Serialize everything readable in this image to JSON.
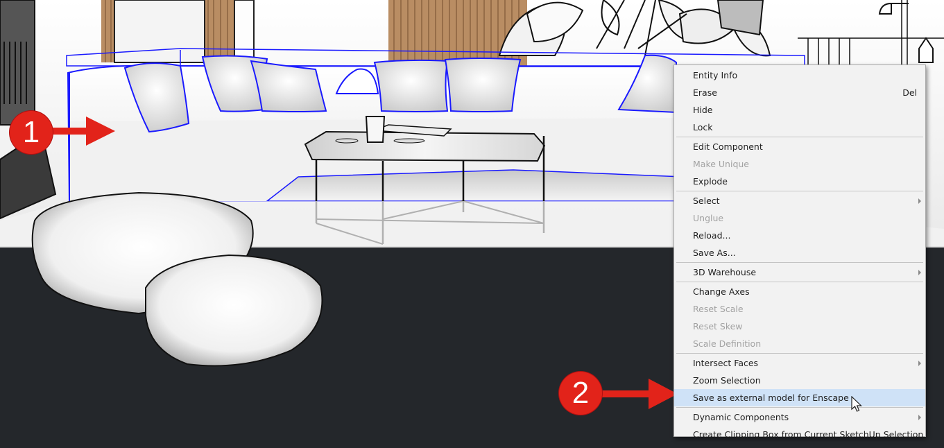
{
  "context_menu": {
    "items": [
      {
        "label": "Entity Info",
        "enabled": true
      },
      {
        "label": "Erase",
        "shortcut": "Del",
        "enabled": true
      },
      {
        "label": "Hide",
        "enabled": true
      },
      {
        "label": "Lock",
        "enabled": true
      },
      {
        "label": "Edit Component",
        "enabled": true
      },
      {
        "label": "Make Unique",
        "enabled": false
      },
      {
        "label": "Explode",
        "enabled": true
      },
      {
        "label": "Select",
        "submenu": true,
        "enabled": true
      },
      {
        "label": "Unglue",
        "enabled": false
      },
      {
        "label": "Reload...",
        "enabled": true
      },
      {
        "label": "Save As...",
        "enabled": true
      },
      {
        "label": "3D Warehouse",
        "submenu": true,
        "enabled": true
      },
      {
        "label": "Change Axes",
        "enabled": true
      },
      {
        "label": "Reset Scale",
        "enabled": false
      },
      {
        "label": "Reset Skew",
        "enabled": false
      },
      {
        "label": "Scale Definition",
        "enabled": false
      },
      {
        "label": "Intersect Faces",
        "submenu": true,
        "enabled": true
      },
      {
        "label": "Zoom Selection",
        "enabled": true
      },
      {
        "label": "Save as external model for Enscape",
        "enabled": true,
        "highlighted": true
      },
      {
        "label": "Dynamic Components",
        "submenu": true,
        "enabled": true
      },
      {
        "label": "Create Clipping Box from Current SketchUp Selection",
        "enabled": true
      }
    ]
  },
  "callouts": {
    "step1": "1",
    "step2": "2"
  },
  "colors": {
    "selection_outline": "#1a1aff",
    "callout_red": "#e2231a",
    "floor": "#24272b",
    "menu_highlight": "#cfe2f7"
  }
}
